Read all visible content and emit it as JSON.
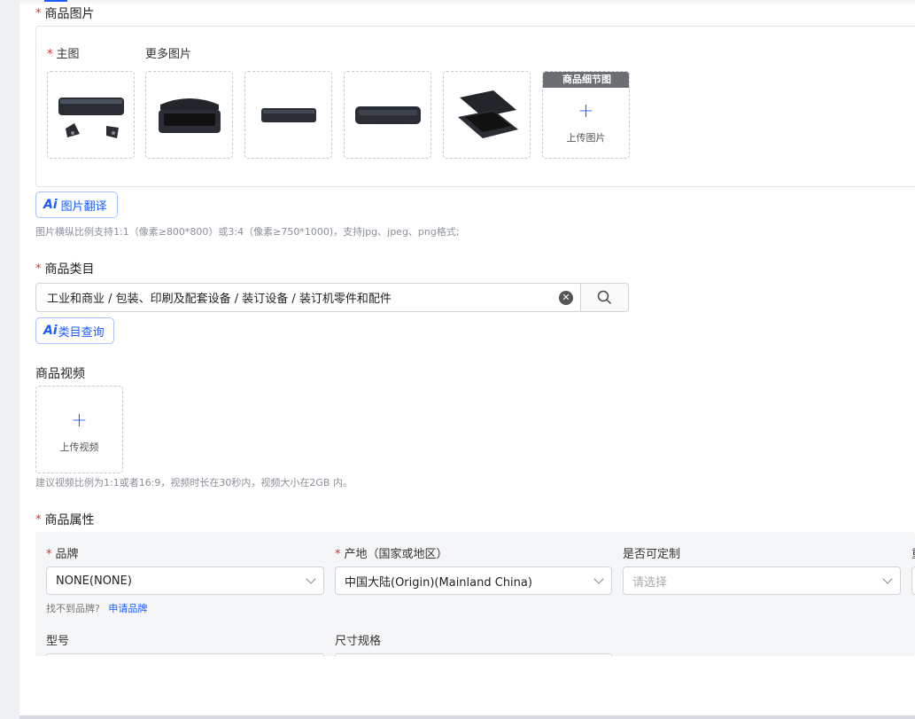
{
  "images_section": {
    "title": "商品图片",
    "main_label": "主图",
    "more_label": "更多图片",
    "detail_badge": "商品细节图",
    "upload_image": "上传图片",
    "translate_button": "图片翻译",
    "hint": "图片横纵比例支持1:1（像素≥800*800）或3:4（像素≥750*1000)，支持jpg、jpeg、png格式;"
  },
  "category_section": {
    "title": "商品类目",
    "value": "工业和商业 / 包装、印刷及配套设备 / 装订设备 / 装订机零件和配件",
    "query_button": "类目查询"
  },
  "video_section": {
    "title": "商品视频",
    "upload": "上传视频",
    "hint": "建议视频比例为1:1或者16:9，视频时长在30秒内，视频大小在2GB 内。"
  },
  "attributes_section": {
    "title": "商品属性",
    "brand_label": "品牌",
    "brand_value": "NONE(NONE)",
    "brand_missing": "找不到品牌?",
    "brand_apply": "申请品牌",
    "origin_label": "产地（国家或地区）",
    "origin_value": "中国大陆(Origin)(Mainland China)",
    "custom_label": "是否可定制",
    "custom_placeholder": "请选择",
    "fourth_label_partial": "重",
    "model_label": "型号",
    "size_label": "尺寸规格"
  },
  "ai_label": "Ai",
  "colors": {
    "accent": "#1a5cff",
    "required": "#e02e2e"
  }
}
